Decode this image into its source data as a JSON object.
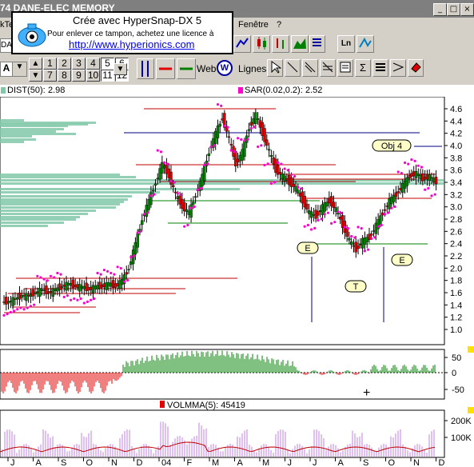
{
  "window": {
    "title_fragment": "74 DANE-ELEC MEMORY",
    "min_icon": "minimize-icon",
    "max_icon": "maximize-icon",
    "close_icon": "close-icon"
  },
  "menubar": {
    "left": "kTe",
    "fenetre": "Fenêtre",
    "help": "?",
    "dropdown": "DA"
  },
  "stamp": {
    "line1": "Crée avec HyperSnap-DX 5",
    "line2": "Pour enlever ce tampon, achetez une licence à",
    "line3": "http://www.hyperionics.com"
  },
  "toolbar": {
    "mode": "A",
    "numbers_row1": [
      "1",
      "2",
      "3",
      "4",
      "5",
      "6"
    ],
    "numbers_row2": [
      "7",
      "8",
      "9",
      "10",
      "11",
      "12"
    ],
    "selected_numbers": [
      "5",
      "6",
      "11",
      "12"
    ],
    "web_label": "Web",
    "lignes_label": "Lignes",
    "icons": [
      "scale-icon",
      "volume-bars-icon",
      "red-line-icon",
      "green-line-icon",
      "web-icon",
      "cursor-icon",
      "line-tool-icon",
      "diagonal-tool-icon",
      "fibonacci-icon",
      "text-tool-icon",
      "sigma-icon",
      "hlines-icon",
      "arrow-icon",
      "eraser-icon",
      "line-chart-icon",
      "candle-icon",
      "bar-chart-icon",
      "mountain-icon",
      "ln-icon",
      "zigzag-icon"
    ]
  },
  "indicators": {
    "dist_label": "DIST(50):",
    "dist_value": "2.98",
    "sar_label": "SAR(0.02,0.2):",
    "sar_value": "2.52",
    "volmma_label": "VOLMMA(5):",
    "volmma_value": "45419"
  },
  "annotations": {
    "obj": "Obj 4",
    "e1": "E",
    "e2": "E",
    "t": "T"
  },
  "colors": {
    "up": "#008000",
    "down": "#e00000",
    "sar": "#ff00cc",
    "profile": "#80c8a8",
    "volume": "#c080e0",
    "ma": "#c00000",
    "blue": "#000080"
  },
  "chart_data": {
    "type": "candlestick",
    "price_axis": {
      "ticks": [
        "4.6",
        "4.4",
        "4.2",
        "4.0",
        "3.8",
        "3.6",
        "3.4",
        "3.2",
        "3.0",
        "2.8",
        "2.6",
        "2.4",
        "2.2",
        "2.0",
        "1.8",
        "1.6",
        "1.4",
        "1.2",
        "1.0"
      ],
      "ylim": [
        1.0,
        4.6
      ]
    },
    "osc_axis": {
      "ticks": [
        "50",
        "0",
        "-50"
      ]
    },
    "volume_axis": {
      "ticks": [
        "200K",
        "100K"
      ]
    },
    "x_axis": {
      "ticks": [
        "J",
        "A",
        "S",
        "O",
        "N",
        "D",
        "04",
        "F",
        "M",
        "A",
        "M",
        "J",
        "J",
        "A",
        "S",
        "O",
        "N",
        "D"
      ]
    },
    "close_path": [
      1.45,
      1.5,
      1.55,
      1.55,
      1.6,
      1.65,
      1.6,
      1.65,
      1.7,
      1.75,
      1.7,
      1.7,
      1.65,
      1.7,
      1.7,
      1.75,
      1.7,
      1.8,
      2.0,
      2.4,
      2.8,
      3.1,
      3.4,
      3.7,
      3.5,
      3.2,
      3.0,
      2.9,
      3.2,
      3.5,
      3.9,
      4.2,
      4.45,
      4.1,
      3.7,
      3.9,
      4.3,
      4.5,
      4.2,
      3.9,
      3.6,
      3.5,
      3.4,
      3.3,
      3.1,
      2.9,
      2.85,
      3.0,
      3.1,
      2.95,
      2.7,
      2.45,
      2.3,
      2.45,
      2.5,
      2.7,
      2.9,
      3.1,
      3.2,
      3.35,
      3.5,
      3.55,
      3.45,
      3.5,
      3.4
    ]
  }
}
